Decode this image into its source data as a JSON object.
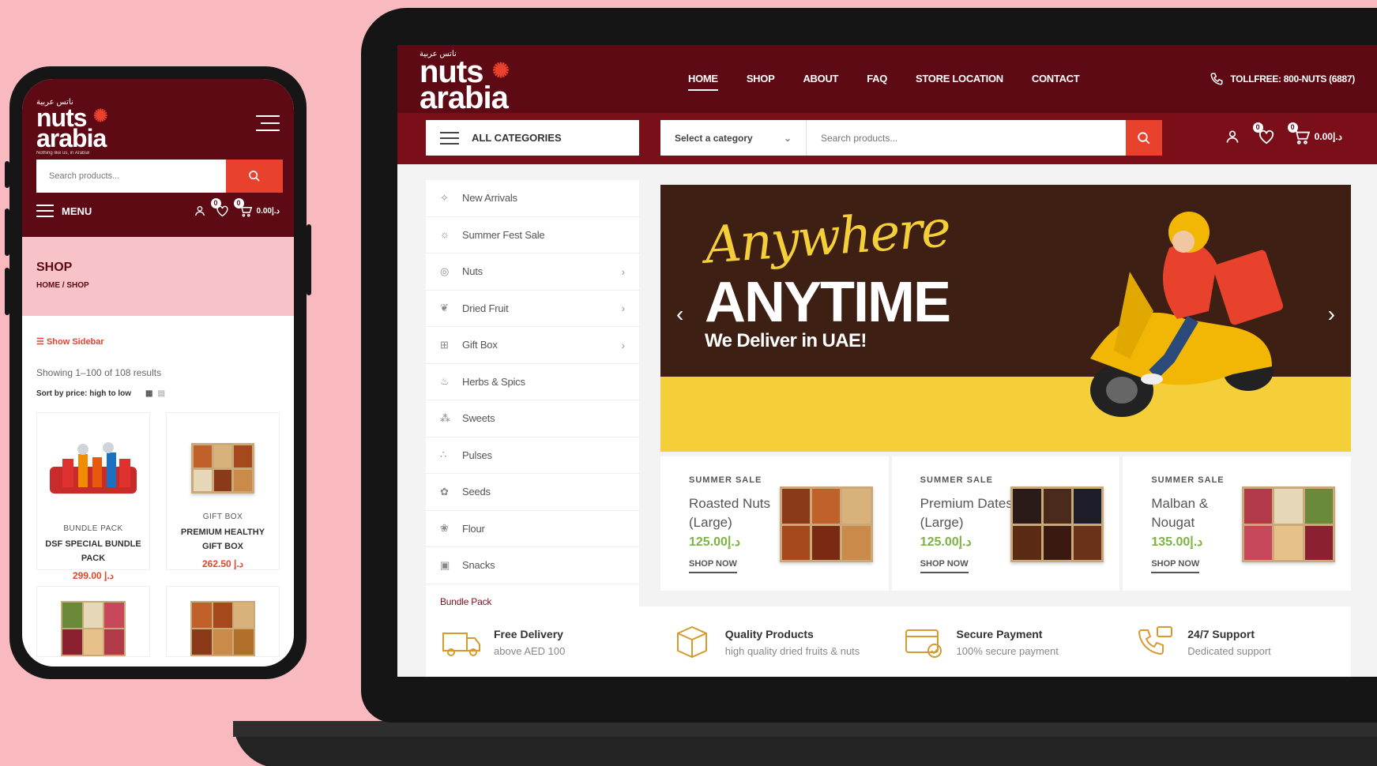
{
  "desktop": {
    "logo": {
      "arabic": "ناتس عربية",
      "main_top": "nuts",
      "main_bottom": "arabia",
      "tagline": "Nothing like us, in Arabia!"
    },
    "nav": [
      {
        "label": "HOME",
        "active": true
      },
      {
        "label": "SHOP"
      },
      {
        "label": "ABOUT"
      },
      {
        "label": "FAQ"
      },
      {
        "label": "STORE LOCATION"
      },
      {
        "label": "CONTACT"
      }
    ],
    "tollfree": "TOLLFREE: 800-NUTS (6887)",
    "all_categories": "ALL CATEGORIES",
    "select_category": "Select a category",
    "search_placeholder": "Search products...",
    "wishlist_count": "0",
    "cart_count": "0",
    "cart_total": "د.إ0.00",
    "sidebar": [
      {
        "label": "New Arrivals",
        "icon": "sparkle-icon"
      },
      {
        "label": "Summer Fest Sale",
        "icon": "sun-icon"
      },
      {
        "label": "Nuts",
        "icon": "nut-icon",
        "sub": true
      },
      {
        "label": "Dried Fruit",
        "icon": "fruit-icon",
        "sub": true
      },
      {
        "label": "Gift Box",
        "icon": "gift-icon",
        "sub": true
      },
      {
        "label": "Herbs & Spics",
        "icon": "herb-icon"
      },
      {
        "label": "Sweets",
        "icon": "sweets-icon"
      },
      {
        "label": "Pulses",
        "icon": "pulses-icon"
      },
      {
        "label": "Seeds",
        "icon": "seeds-icon"
      },
      {
        "label": "Flour",
        "icon": "flour-icon"
      },
      {
        "label": "Snacks",
        "icon": "snacks-icon"
      },
      {
        "label": "Bundle Pack",
        "icon": ""
      }
    ],
    "banner": {
      "script": "Anywhere",
      "headline": "ANYTIME",
      "sub": "We Deliver in UAE!"
    },
    "promos": [
      {
        "sale": "SUMMER SALE",
        "name": "Roasted Nuts (Large)",
        "price": "125.00د.إ",
        "cta": "SHOP NOW"
      },
      {
        "sale": "SUMMER SALE",
        "name": "Premium Dates (Large)",
        "price": "125.00د.إ",
        "cta": "SHOP NOW"
      },
      {
        "sale": "SUMMER SALE",
        "name": "Malban & Nougat",
        "price": "135.00د.إ",
        "cta": "SHOP NOW"
      }
    ],
    "features": [
      {
        "title": "Free Delivery",
        "sub": "above AED 100",
        "icon": "truck-icon"
      },
      {
        "title": "Quality Products",
        "sub": "high quality dried fruits & nuts",
        "icon": "box-icon"
      },
      {
        "title": "Secure Payment",
        "sub": "100% secure payment",
        "icon": "card-icon"
      },
      {
        "title": "24/7 Support",
        "sub": "Dedicated support",
        "icon": "phone-support-icon"
      }
    ]
  },
  "mobile": {
    "search_placeholder": "Search products...",
    "menu_label": "MENU",
    "wishlist_count": "0",
    "cart_count": "0",
    "cart_total": "د.إ0.00",
    "page_title": "SHOP",
    "breadcrumb": "HOME / SHOP",
    "show_sidebar": "Show Sidebar",
    "result_count": "Showing 1–100 of 108 results",
    "sort": "Sort by price: high to low",
    "products": [
      {
        "category": "BUNDLE PACK",
        "name": "DSF SPECIAL BUNDLE PACK",
        "price": "د.إ 299.00"
      },
      {
        "category": "GIFT BOX",
        "name": "PREMIUM HEALTHY GIFT BOX",
        "price": "د.إ 262.50"
      }
    ]
  },
  "colors": {
    "brand": "#5e0a14",
    "accent": "#e8412c",
    "price_green": "#7cb342",
    "banner_yellow": "#f5cf3a",
    "background": "#f8b9bf"
  }
}
